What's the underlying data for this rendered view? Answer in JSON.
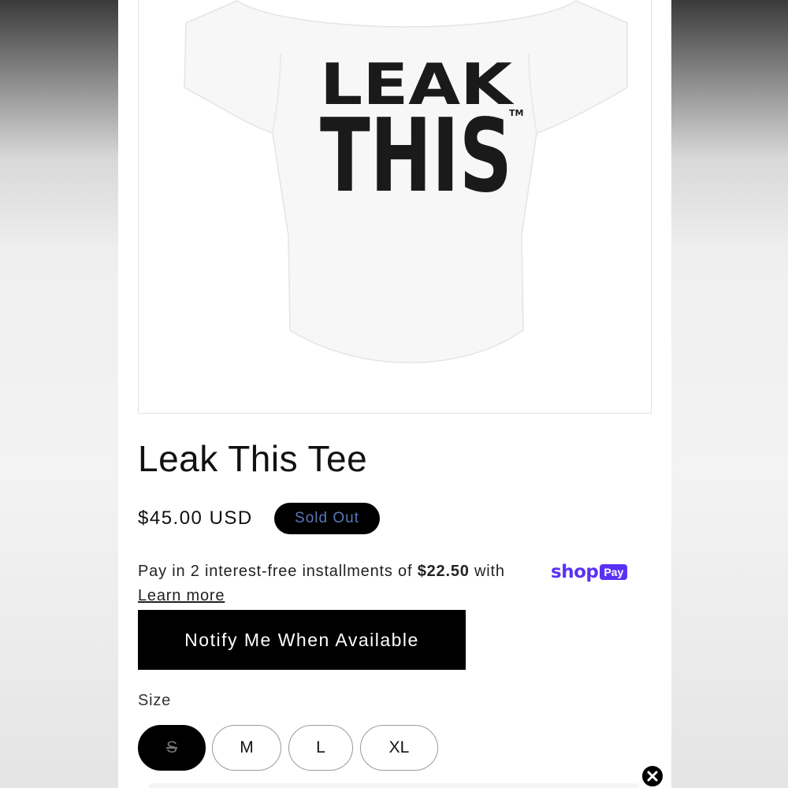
{
  "product": {
    "title": "Leak This Tee",
    "price": "$45.00 USD",
    "badge": "Sold Out",
    "image": {
      "line1": "LEAK",
      "line2": "THIS",
      "trademark": "TM"
    }
  },
  "installments": {
    "prefix": "Pay in 2 interest-free installments of ",
    "amount": "$22.50",
    "suffix": " with ",
    "shop_word": "shop",
    "pay_word": "Pay",
    "learn_more": "Learn more"
  },
  "notify_button": "Notify Me When Available",
  "size": {
    "label": "Size",
    "options": [
      "S",
      "M",
      "L",
      "XL"
    ],
    "selected": "S"
  },
  "colors": {
    "shop_pay": "#5a31f4",
    "badge_text": "#5a77b8"
  },
  "icons": {
    "close": "close-icon"
  }
}
